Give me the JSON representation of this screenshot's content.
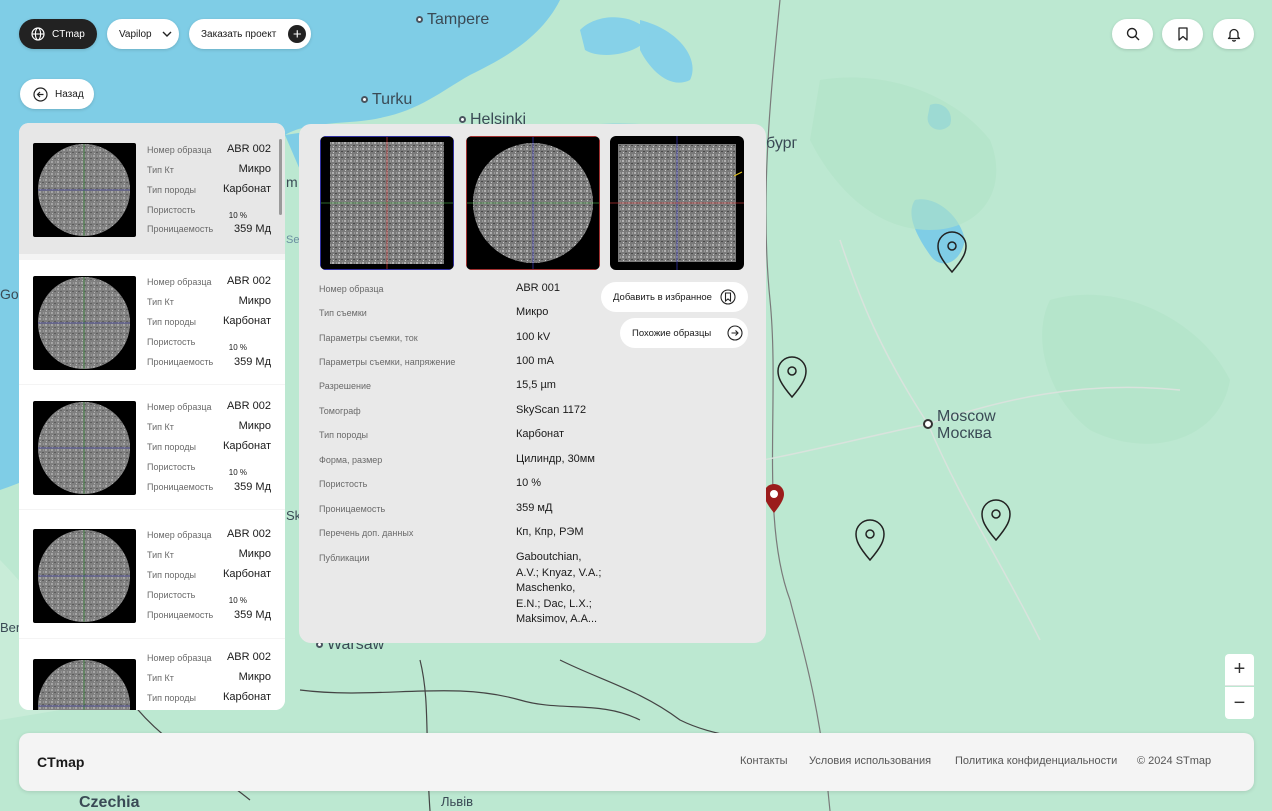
{
  "header": {
    "brand_label": "CTmap",
    "region_label": "Vapilop",
    "order_label": "Заказать проект"
  },
  "back_label": "Назад",
  "map": {
    "labels": [
      "Tampere",
      "Turku",
      "Helsinki",
      "бург",
      "Moscow",
      "Москва",
      "Warsaw",
      "Czechia",
      "Львів",
      "Go",
      "Berl",
      "m",
      "Se",
      "Sk"
    ],
    "zoom_in": "+",
    "zoom_out": "−"
  },
  "sample_list": [
    {
      "id_label": "Номер образца",
      "id": "ABR 002",
      "ct_label": "Тип Кт",
      "ct": "Микро",
      "rock_label": "Тип породы",
      "rock": "Карбонат",
      "porosity_label": "Пористость",
      "porosity": "10 %",
      "perm_label": "Проницаемость",
      "perm": "359 Мд"
    },
    {
      "id_label": "Номер образца",
      "id": "ABR 002",
      "ct_label": "Тип Кт",
      "ct": "Микро",
      "rock_label": "Тип породы",
      "rock": "Карбонат",
      "porosity_label": "Пористость",
      "porosity": "10 %",
      "perm_label": "Проницаемость",
      "perm": "359 Мд"
    },
    {
      "id_label": "Номер образца",
      "id": "ABR 002",
      "ct_label": "Тип Кт",
      "ct": "Микро",
      "rock_label": "Тип породы",
      "rock": "Карбонат",
      "porosity_label": "Пористость",
      "porosity": "10 %",
      "perm_label": "Проницаемость",
      "perm": "359 Мд"
    },
    {
      "id_label": "Номер образца",
      "id": "ABR 002",
      "ct_label": "Тип Кт",
      "ct": "Микро",
      "rock_label": "Тип породы",
      "rock": "Карбонат",
      "porosity_label": "Пористость",
      "porosity": "10 %",
      "perm_label": "Проницаемость",
      "perm": "359 Мд"
    },
    {
      "id_label": "Номер образца",
      "id": "ABR 002",
      "ct_label": "Тип Кт",
      "ct": "Микро",
      "rock_label": "Тип породы",
      "rock": "Карбонат"
    }
  ],
  "detail": {
    "rows": [
      {
        "label": "Номер образца",
        "value": "ABR 001"
      },
      {
        "label": "Тип съемки",
        "value": "Микро"
      },
      {
        "label": "Параметры съемки, ток",
        "value": "100 kV"
      },
      {
        "label": "Параметры съемки, напряжение",
        "value": "100 mA"
      },
      {
        "label": "Разрешение",
        "value": "15,5 µm"
      },
      {
        "label": "Томограф",
        "value": "SkyScan 1172"
      },
      {
        "label": "Тип породы",
        "value": "Карбонат"
      },
      {
        "label": "Форма, размер",
        "value": "Цилиндр, 30мм"
      },
      {
        "label": "Пористость",
        "value": "10 %"
      },
      {
        "label": "Проницаемость",
        "value": "359 мД"
      },
      {
        "label": "Перечень доп. данных",
        "value": "Кп, Кпр, РЭМ"
      },
      {
        "label": "Публикации",
        "value": "Gaboutchian,\nA.V.; Knyaz, V.A.;\nMaschenko,\nE.N.; Dac, L.X.;\nMaksimov, A.A..."
      }
    ],
    "favorite_label": "Добавить в избранное",
    "similar_label": "Похожие образцы"
  },
  "footer": {
    "brand": "CTmap",
    "links": [
      "Контакты",
      "Условия использования",
      "Политика конфиденциальности",
      "© 2024 STmap"
    ]
  },
  "colors": {
    "map_land": "#b9e7cf",
    "map_water": "#7fcde6",
    "dark": "#222222",
    "panel": "#e9e9e9",
    "marker_selected": "#9b1c1c"
  },
  "icons": {
    "brand": "globe-icon",
    "region": "chevron-down-icon",
    "order": "plus-icon",
    "search": "search-icon",
    "bookmark": "bookmark-icon",
    "notifications": "bell-icon",
    "back": "arrow-left-icon",
    "favorite": "bookmark-icon",
    "similar": "arrow-right-icon",
    "map_marker": "location-pin-icon"
  }
}
